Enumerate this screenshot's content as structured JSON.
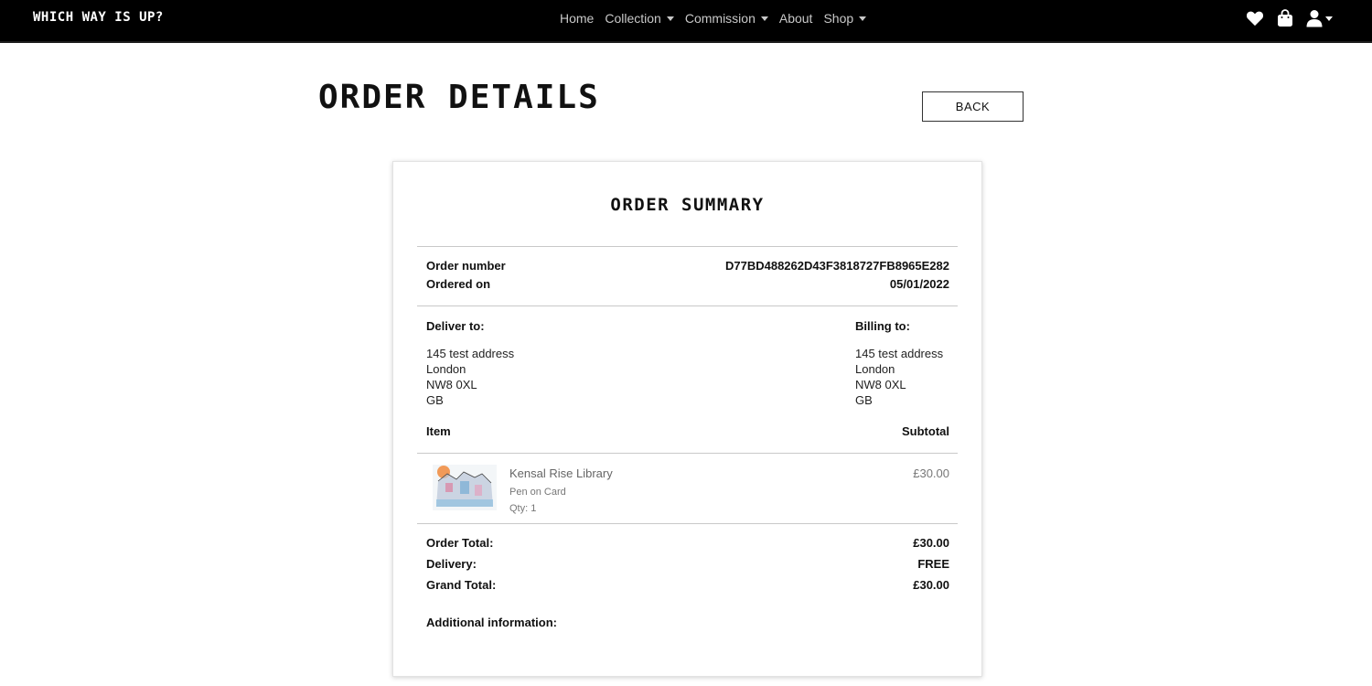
{
  "nav": {
    "brand": "Which Way Is Up?",
    "links": [
      {
        "label": "Home"
      },
      {
        "label": "Collection"
      },
      {
        "label": "Commission"
      },
      {
        "label": "About"
      },
      {
        "label": "Shop"
      }
    ],
    "icons": [
      "heart-icon",
      "shopping-bag-icon",
      "user-icon"
    ]
  },
  "page": {
    "title": "Order Details",
    "back_label": "BACK"
  },
  "summary": {
    "title": "Order Summary",
    "order_number_label": "Order number",
    "order_number": "D77BD488262D43F3818727FB8965E282",
    "ordered_on_label": "Ordered on",
    "ordered_on": "05/01/2022",
    "deliver_to_label": "Deliver to:",
    "billing_to_label": "Billing to:",
    "delivery_address": [
      "145 test address",
      "London",
      "NW8 0XL",
      "GB"
    ],
    "billing_address": [
      "145 test address",
      "London",
      "NW8 0XL",
      "GB"
    ],
    "item_header": "Item",
    "subtotal_header": "Subtotal",
    "items": [
      {
        "name": "Kensal Rise Library",
        "medium": "Pen on Card",
        "qty": "Qty: 1",
        "price": "£30.00"
      }
    ],
    "order_total_label": "Order Total:",
    "order_total": "£30.00",
    "delivery_label": "Delivery:",
    "delivery": "FREE",
    "grand_total_label": "Grand Total:",
    "grand_total": "£30.00",
    "additional_info_label": "Additional information:"
  },
  "colors": {
    "navbar_bg": "#000000",
    "nav_text": "#c8c8c8",
    "page_bg": "#ffffff"
  }
}
